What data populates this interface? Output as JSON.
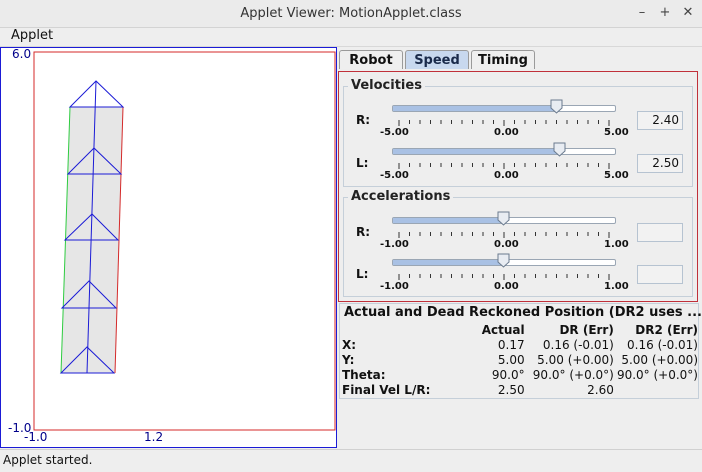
{
  "window": {
    "title": "Applet Viewer: MotionApplet.class",
    "min": "–",
    "max": "+",
    "close": "✕"
  },
  "menu": {
    "applet": "Applet"
  },
  "plot": {
    "ymax": "6.0",
    "ymin": "-1.0",
    "xmin": "-1.0",
    "xmax": "1.2"
  },
  "tabs": [
    "Robot",
    "Speed",
    "Timing"
  ],
  "active_tab": "Speed",
  "velocities": {
    "title": "Velocities",
    "r": {
      "label": "R:",
      "value": "2.40",
      "fraction": 0.74
    },
    "l": {
      "label": "L:",
      "value": "2.50",
      "fraction": 0.75
    },
    "ticks": [
      "-5.00",
      "0.00",
      "5.00"
    ]
  },
  "accelerations": {
    "title": "Accelerations",
    "r": {
      "label": "R:",
      "value": "",
      "fraction": 0.5
    },
    "l": {
      "label": "L:",
      "value": "",
      "fraction": 0.5
    },
    "ticks": [
      "-1.00",
      "0.00",
      "1.00"
    ]
  },
  "position": {
    "title": "Actual and Dead Reckoned Position (DR2 uses ...",
    "columns": [
      "",
      "Actual",
      "DR (Err)",
      "DR2 (Err)"
    ],
    "rows": [
      [
        "X:",
        "0.17",
        "0.16 (-0.01)",
        "0.16 (-0.01)"
      ],
      [
        "Y:",
        "5.00",
        "5.00 (+0.00)",
        "5.00 (+0.00)"
      ],
      [
        "Theta:",
        "90.0°",
        "90.0° (+0.0°)",
        "90.0° (+0.0°)"
      ],
      [
        "Final Vel L/R:",
        "2.50",
        "2.60",
        ""
      ]
    ]
  },
  "status": "Applet started.",
  "colors": {
    "accent": "#1b1bd6",
    "border_red": "#c0303a",
    "path_green": "#2ecc40"
  }
}
